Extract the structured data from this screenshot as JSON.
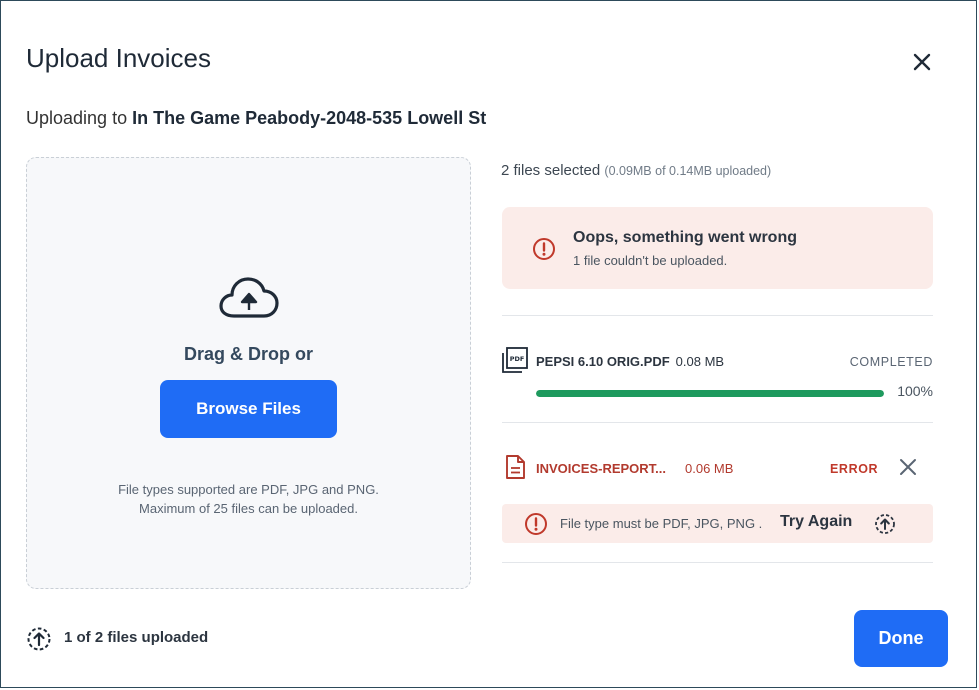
{
  "dialog": {
    "title": "Upload Invoices",
    "subtitle_prefix": "Uploading to ",
    "subtitle_target": "In The Game Peabody-2048-535 Lowell St"
  },
  "dropzone": {
    "drag_label": "Drag & Drop or",
    "browse_label": "Browse Files",
    "hint_line1": "File types supported are PDF, JPG and PNG.",
    "hint_line2": "Maximum of 25 files can be uploaded."
  },
  "summary": {
    "files_selected": "2 files selected",
    "upload_detail": "(0.09MB of 0.14MB uploaded)"
  },
  "alert": {
    "title": "Oops, something went wrong",
    "message": "1 file couldn't be uploaded."
  },
  "files": [
    {
      "name": "PEPSI 6.10 ORIG.PDF",
      "size": "0.08 MB",
      "status": "COMPLETED",
      "progress_percent": 100,
      "progress_label": "100%"
    },
    {
      "name": "INVOICES-REPORT...",
      "size": "0.06 MB",
      "status": "ERROR",
      "error_message": "File type must be PDF, JPG, PNG .",
      "retry_label": "Try Again"
    }
  ],
  "footer": {
    "status": "1 of 2 files uploaded",
    "done_label": "Done"
  },
  "colors": {
    "primary": "#1f6cf5",
    "success": "#1e9a5e",
    "error": "#c0392b",
    "alert_bg": "#fbece9"
  },
  "icons": [
    "close-icon",
    "cloud-upload-icon",
    "alert-circle-icon",
    "pdf-file-icon",
    "document-icon",
    "retry-upload-icon",
    "upload-progress-icon"
  ]
}
